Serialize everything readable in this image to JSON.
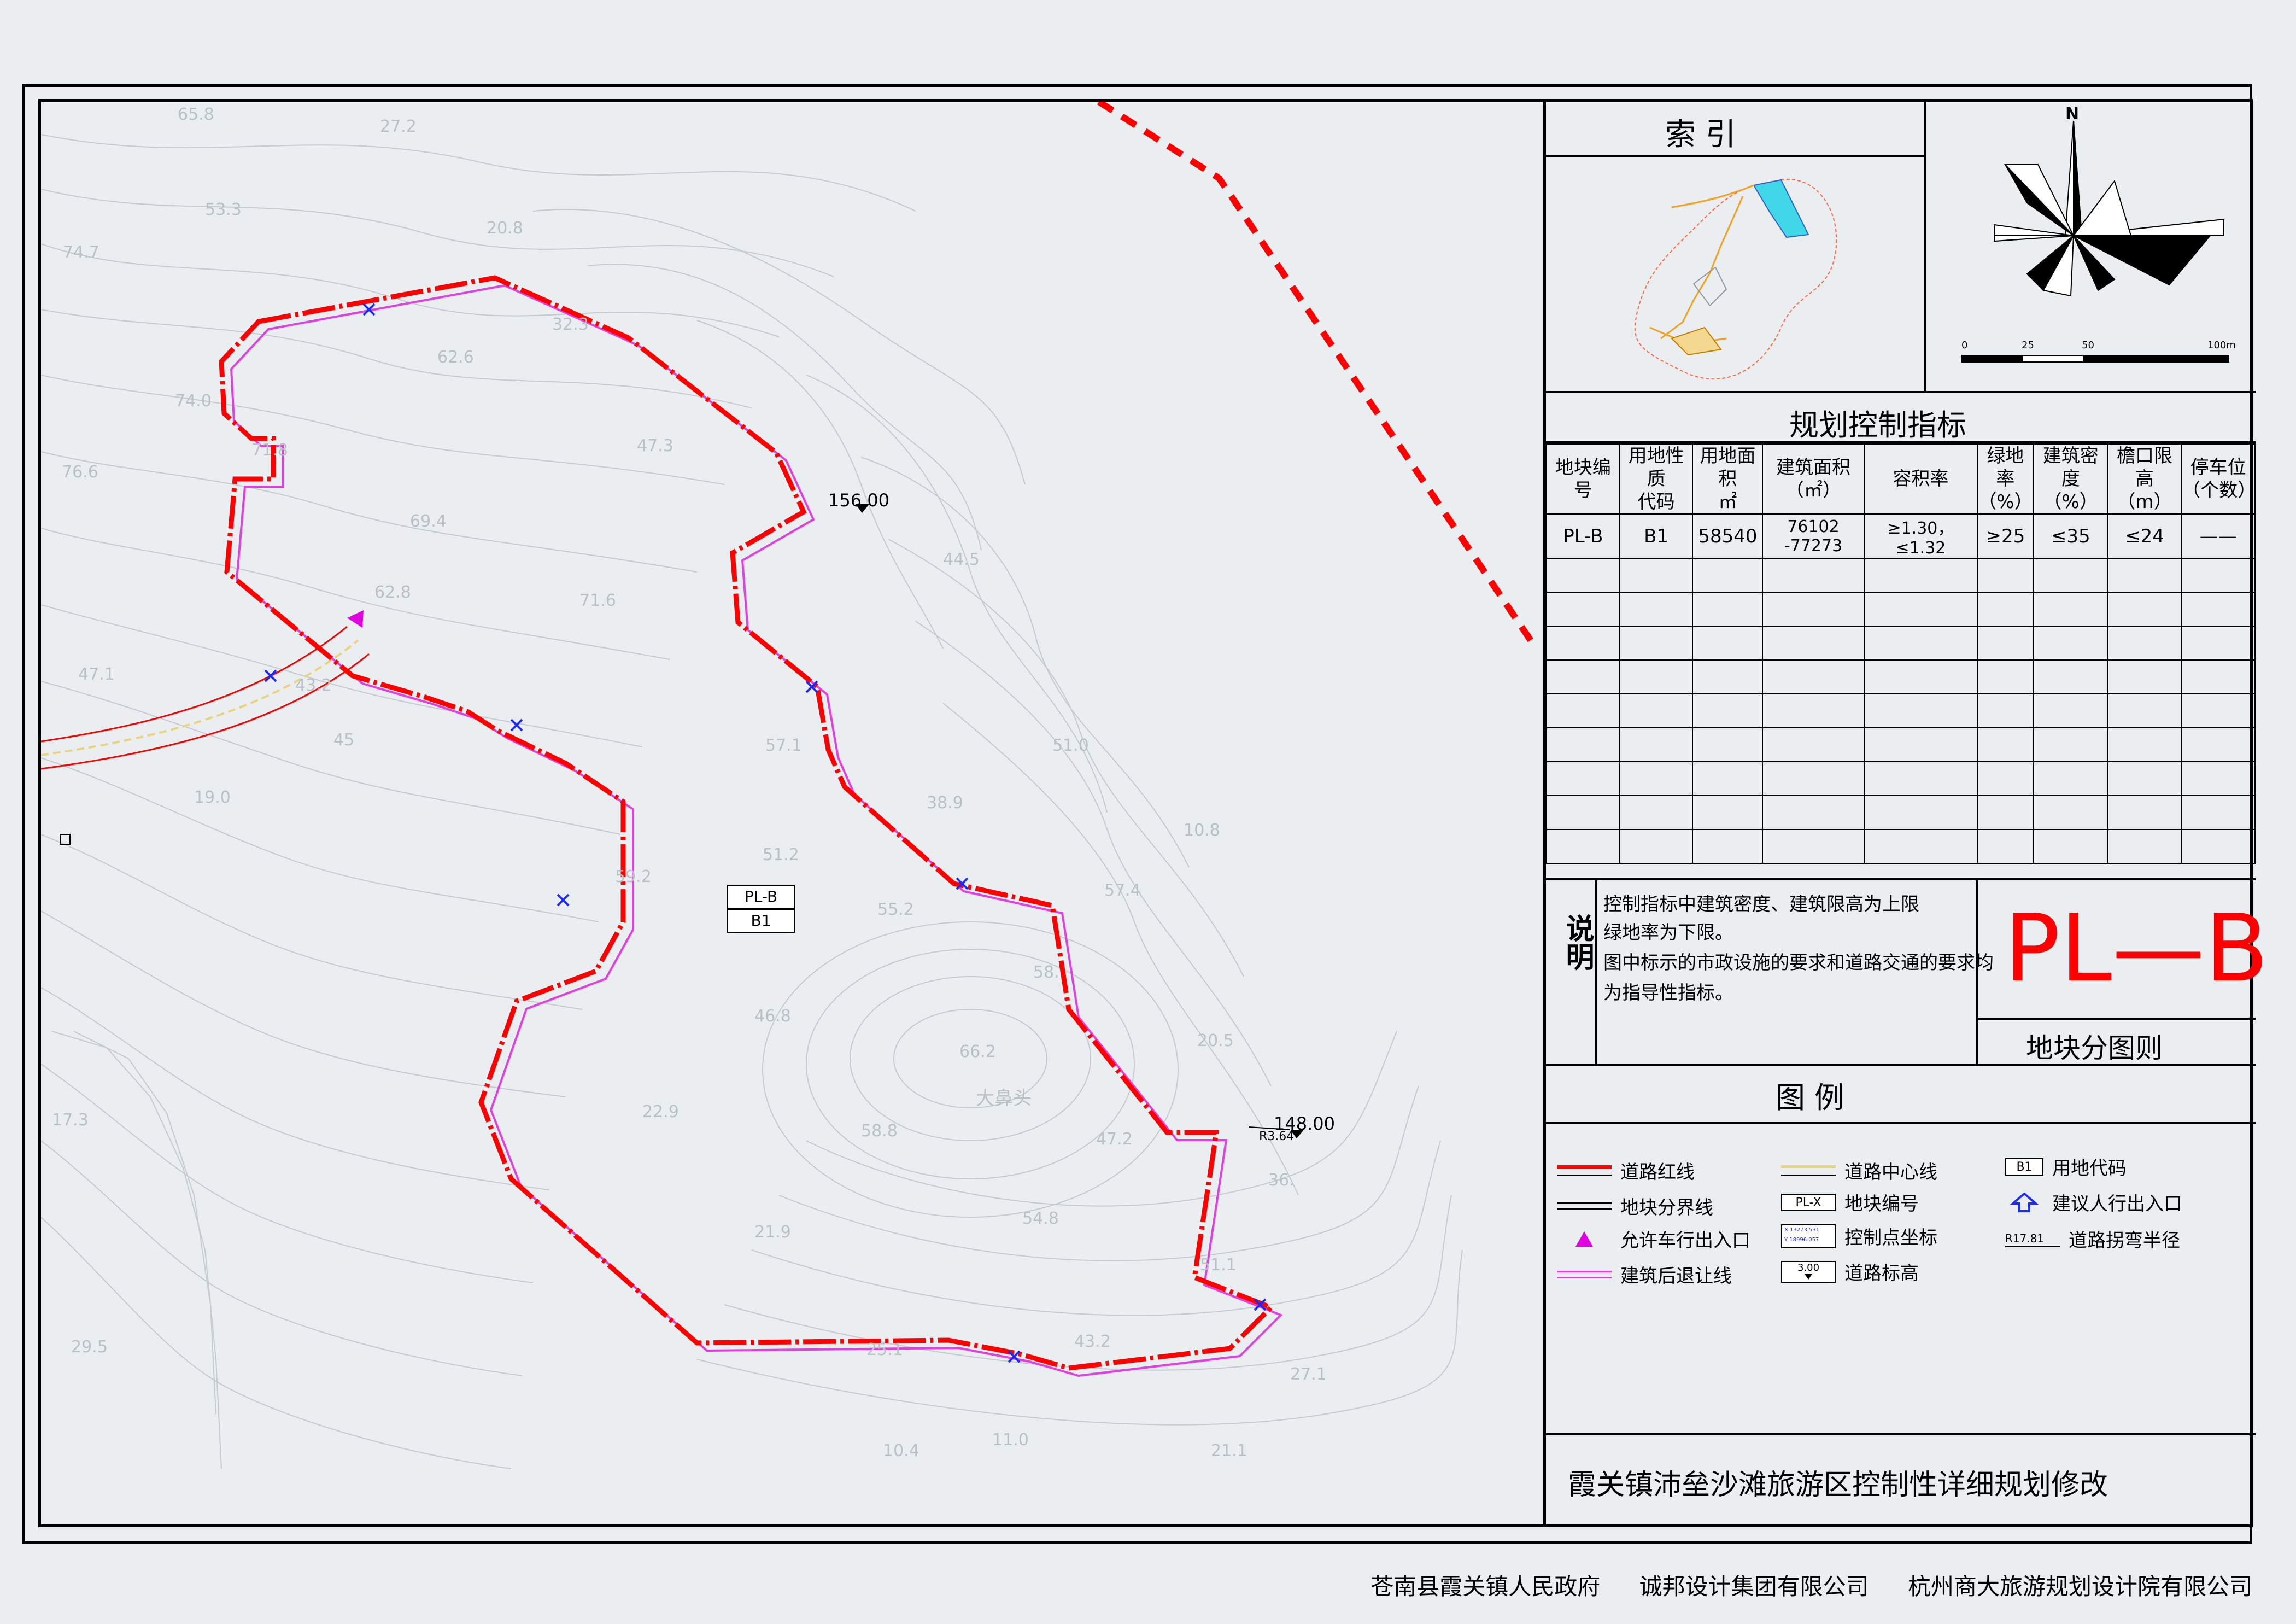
{
  "index_title": "索    引",
  "north_label": "N",
  "scale": {
    "ticks": [
      "0",
      "25",
      "50",
      "100m"
    ]
  },
  "control_title": "规划控制指标",
  "table": {
    "headers": [
      "地块编号",
      "用地性质\n代码",
      "用地面积\n㎡",
      "建筑面积\n（㎡）",
      "容积率",
      "绿地率\n（%）",
      "建筑密度\n（%）",
      "檐口限高\n（m）",
      "停车位\n（个数）"
    ],
    "rows": [
      [
        "PL-B",
        "B1",
        "58540",
        "76102 -77273",
        "≥1.30，≤1.32",
        "≥25",
        "≤35",
        "≤24",
        "——"
      ]
    ],
    "empty_rows": 9
  },
  "notes": {
    "label": "说明",
    "lines": [
      "控制指标中建筑密度、建筑限高为上限",
      "绿地率为下限。",
      "图中标示的市政设施的要求和道路交通的要求均",
      "为指导性指标。"
    ]
  },
  "plot_code": "PL—B",
  "plot_subtitle": "地块分图则",
  "legend_title": "图          例",
  "legend": [
    {
      "label": "道路红线",
      "symbol": "red-line"
    },
    {
      "label": "道路中心线",
      "symbol": "yellow-line"
    },
    {
      "label": "用地代码",
      "symbol": "B1"
    },
    {
      "label": "地块分界线",
      "symbol": "black-line"
    },
    {
      "label": "地块编号",
      "symbol": "PL-X"
    },
    {
      "label": "建议人行出入口",
      "symbol": "blue-arrow"
    },
    {
      "label": "允许车行出入口",
      "symbol": "magenta-triangle"
    },
    {
      "label": "控制点坐标",
      "symbol": "coord-box",
      "coord_x": "X 13273.531",
      "coord_y": "Y 18996.057"
    },
    {
      "label": "道路拐弯半径",
      "symbol": "radius",
      "radius": "R17.81"
    },
    {
      "label": "建筑后退让线",
      "symbol": "magenta-line"
    },
    {
      "label": "道路标高",
      "symbol": "elevation",
      "elev": "3.00"
    }
  ],
  "project_title": "霞关镇沛垒沙滩旅游区控制性详细规划修改",
  "footer": [
    "苍南县霞关镇人民政府",
    "诚邦设计集团有限公司",
    "杭州商大旅游规划设计院有限公司"
  ],
  "map": {
    "elev_156": "156.00",
    "elev_148": "148.00",
    "radius_label": "R3.64",
    "plot_label": "PL-B",
    "plot_code": "B1",
    "place_name": "大鼻头",
    "contour_numbers": [
      "65.8",
      "27.2",
      "53.3",
      "20.8",
      "74.7",
      "32.3",
      "62.6",
      "74.0",
      "47.3",
      "71.8",
      "76.6",
      "69.4",
      "62.8",
      "71.6",
      "47.1",
      "43.2",
      "45",
      "57.1",
      "19.0",
      "38.9",
      "51.2",
      "10.8",
      "59.2",
      "55.2",
      "57.4",
      "58.",
      "46.8",
      "66.2",
      "20.5",
      "47.2",
      "22.9",
      "58.8",
      "17.3",
      "54.8",
      "21.9",
      "51.1",
      "36.",
      "25.1",
      "43.2",
      "27.1",
      "29.5",
      "10.4",
      "11.0",
      "21.1",
      "44.5",
      "51.0"
    ]
  },
  "colors": {
    "red": "#ff0000",
    "magenta": "#e040e0",
    "yellow": "#e8d480",
    "cyan": "#40d8e8",
    "contour": "#c4cad0"
  }
}
